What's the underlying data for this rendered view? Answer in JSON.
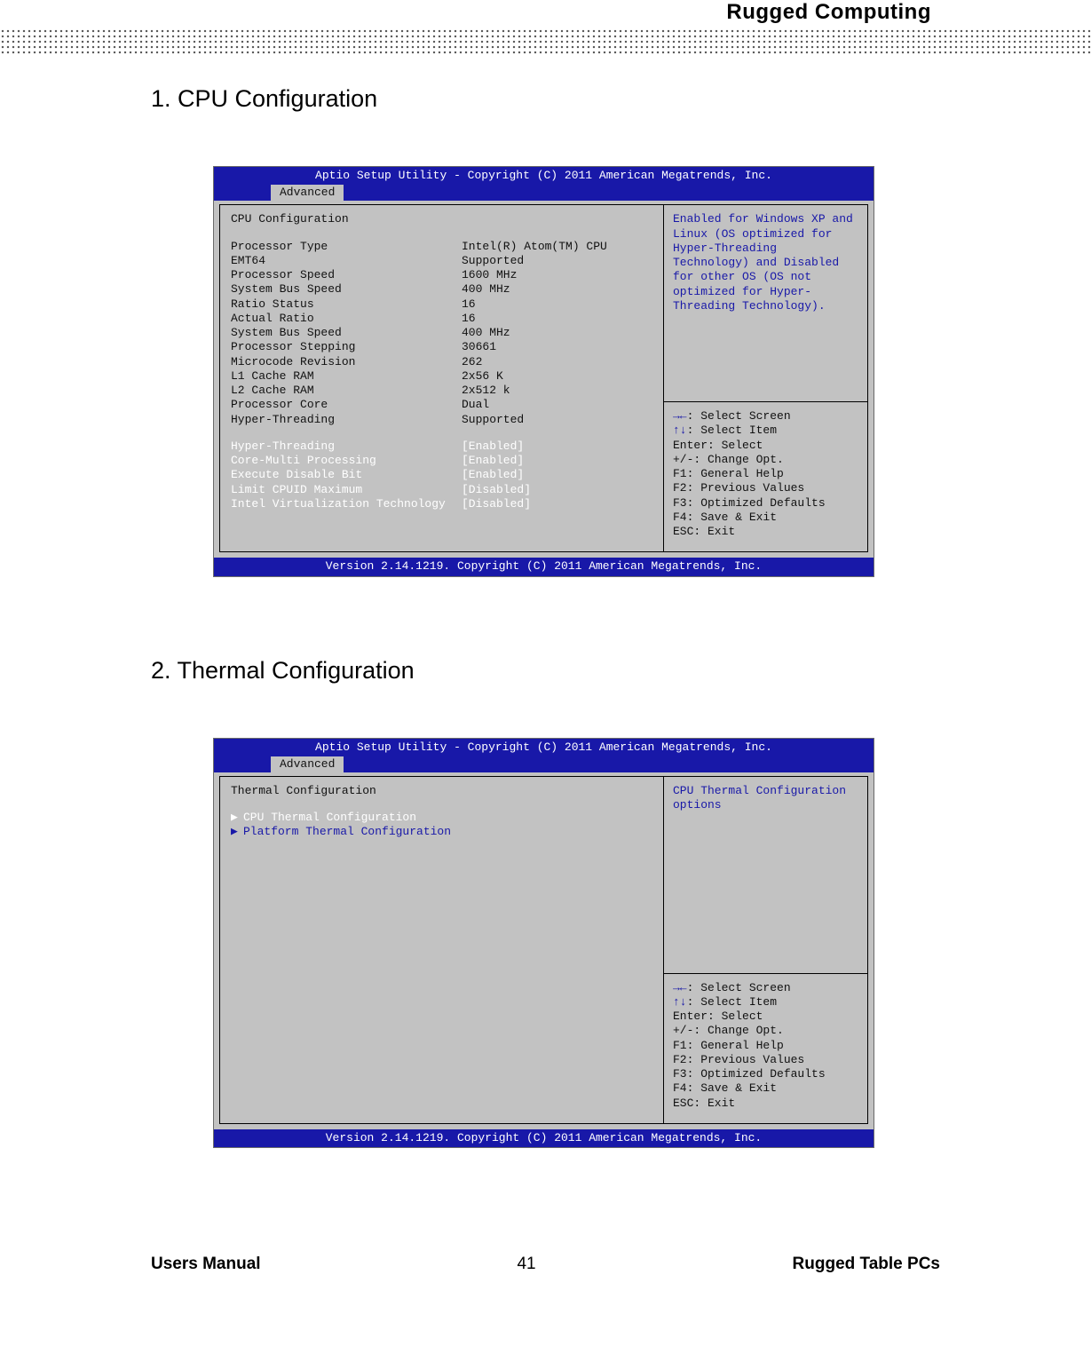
{
  "header_brand": "Rugged  Computing",
  "section1_title": "1.  CPU Configuration",
  "section2_title": "2.  Thermal Configuration",
  "bios_common": {
    "titlebar": "Aptio Setup Utility - Copyright (C) 2011 American Megatrends, Inc.",
    "tab": "Advanced",
    "footer": "Version 2.14.1219. Copyright (C) 2011 American Megatrends, Inc."
  },
  "cpu_screen": {
    "heading": "CPU Configuration",
    "info": [
      {
        "k": "Processor Type",
        "v": "Intel(R) Atom(TM) CPU"
      },
      {
        "k": "EMT64",
        "v": "Supported"
      },
      {
        "k": "Processor Speed",
        "v": "1600 MHz"
      },
      {
        "k": "System Bus Speed",
        "v": "400 MHz"
      },
      {
        "k": "Ratio Status",
        "v": "16"
      },
      {
        "k": "Actual Ratio",
        "v": "16"
      },
      {
        "k": "System Bus Speed",
        "v": "400 MHz"
      },
      {
        "k": "Processor Stepping",
        "v": "30661"
      },
      {
        "k": "Microcode Revision",
        "v": "262"
      },
      {
        "k": "L1 Cache RAM",
        "v": "2x56 K"
      },
      {
        "k": "L2 Cache RAM",
        "v": "2x512 k"
      },
      {
        "k": "Processor Core",
        "v": "Dual"
      },
      {
        "k": "Hyper-Threading",
        "v": "Supported"
      }
    ],
    "options": [
      {
        "k": "Hyper-Threading",
        "v": "[Enabled]"
      },
      {
        "k": "Core-Multi Processing",
        "v": "[Enabled]"
      },
      {
        "k": "Execute Disable Bit",
        "v": "[Enabled]"
      },
      {
        "k": "Limit CPUID Maximum",
        "v": "[Disabled]"
      },
      {
        "k": "Intel Virtualization Technology",
        "v": "[Disabled]"
      }
    ],
    "help_text": "Enabled for Windows XP and Linux (OS optimized for Hyper-Threading Technology) and Disabled for other OS (OS not optimized for Hyper-Threading Technology).",
    "keys": [
      {
        "sym": "→←",
        "txt": ": Select Screen"
      },
      {
        "sym": "↑↓",
        "txt": ": Select Item"
      },
      {
        "sym": "",
        "txt": "Enter: Select"
      },
      {
        "sym": "",
        "txt": "+/-: Change Opt."
      },
      {
        "sym": "",
        "txt": "F1: General Help"
      },
      {
        "sym": "",
        "txt": "F2: Previous Values"
      },
      {
        "sym": "",
        "txt": "F3: Optimized Defaults"
      },
      {
        "sym": "",
        "txt": "F4: Save & Exit"
      },
      {
        "sym": "",
        "txt": "ESC: Exit"
      }
    ]
  },
  "thermal_screen": {
    "heading": "Thermal Configuration",
    "submenus": [
      "CPU Thermal Configuration",
      "Platform Thermal Configuration"
    ],
    "help_text": "CPU Thermal Configuration options",
    "keys": [
      {
        "sym": "→←",
        "txt": ": Select Screen"
      },
      {
        "sym": "↑↓",
        "txt": ": Select Item"
      },
      {
        "sym": "",
        "txt": "Enter: Select"
      },
      {
        "sym": "",
        "txt": "+/-: Change Opt."
      },
      {
        "sym": "",
        "txt": "F1: General Help"
      },
      {
        "sym": "",
        "txt": "F2: Previous Values"
      },
      {
        "sym": "",
        "txt": "F3: Optimized Defaults"
      },
      {
        "sym": "",
        "txt": "F4: Save & Exit"
      },
      {
        "sym": "",
        "txt": "ESC: Exit"
      }
    ]
  },
  "footer": {
    "left": "Users Manual",
    "center": "41",
    "right": "Rugged Table PCs"
  }
}
